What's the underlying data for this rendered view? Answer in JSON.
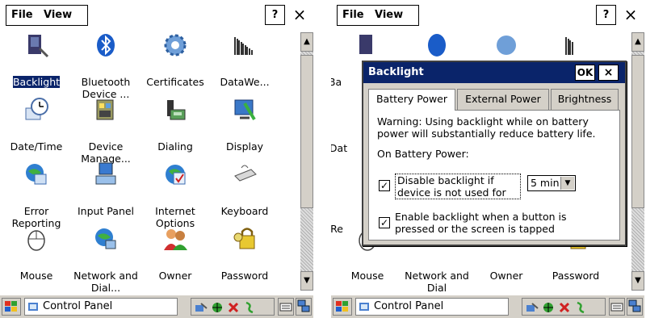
{
  "menu": {
    "file": "File",
    "view": "View",
    "help": "?",
    "close": "×"
  },
  "icons": [
    {
      "label": "Backlight",
      "icon": "backlight-icon"
    },
    {
      "label": "Bluetooth Device ...",
      "icon": "bluetooth-icon"
    },
    {
      "label": "Certificates",
      "icon": "certificates-icon"
    },
    {
      "label": "DataWe...",
      "icon": "datawedge-icon"
    },
    {
      "label": "Date/Time",
      "icon": "clock-icon"
    },
    {
      "label": "Device Manage...",
      "icon": "device-manager-icon"
    },
    {
      "label": "Dialing",
      "icon": "phone-icon"
    },
    {
      "label": "Display",
      "icon": "display-icon"
    },
    {
      "label": "Error Reporting",
      "icon": "error-reporting-icon"
    },
    {
      "label": "Input Panel",
      "icon": "input-panel-icon"
    },
    {
      "label": "Internet Options",
      "icon": "globe-icon"
    },
    {
      "label": "Keyboard",
      "icon": "keyboard-icon"
    },
    {
      "label": "Mouse",
      "icon": "mouse-icon"
    },
    {
      "label": "Network and Dial...",
      "icon": "network-icon"
    },
    {
      "label": "Owner",
      "icon": "owner-icon"
    },
    {
      "label": "Password",
      "icon": "key-icon"
    }
  ],
  "right_visible_labels": {
    "row1": [
      "Ba"
    ],
    "row2": [
      "Dat"
    ],
    "row3": [
      "Re"
    ],
    "row4": [
      "Mouse",
      "Network and Dial",
      "Owner",
      "Password"
    ]
  },
  "taskbar": {
    "task": "Control Panel"
  },
  "dialog": {
    "title": "Backlight",
    "ok": "OK",
    "close": "×",
    "tabs": [
      "Battery Power",
      "External Power",
      "Brightness"
    ],
    "warning": "Warning: Using backlight while on battery power will substantially reduce battery life.",
    "section": "On Battery Power:",
    "option1": {
      "label": "Disable backlight if device is not used for",
      "checked": true
    },
    "timeout": {
      "value": "5 min"
    },
    "option2": {
      "label": "Enable backlight when a button is pressed or the screen is tapped",
      "checked": true
    }
  }
}
